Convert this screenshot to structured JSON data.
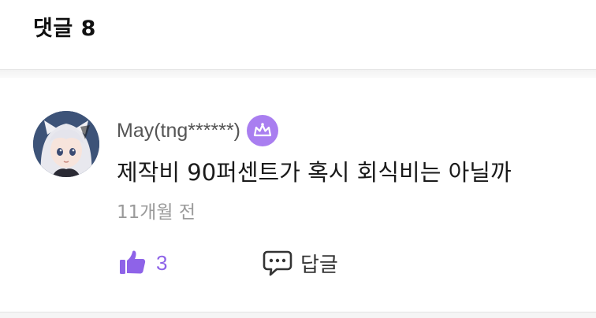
{
  "header": {
    "title": "댓글 8"
  },
  "comment": {
    "author": "May(tng******)",
    "badge_icon": "crown-icon",
    "text": "제작비 90퍼센트가 혹시 회식비는 아닐까",
    "time": "11개월 전",
    "likes": "3",
    "reply_label": "답글"
  },
  "colors": {
    "accent": "#a97ef0",
    "like": "#8e63e8"
  }
}
